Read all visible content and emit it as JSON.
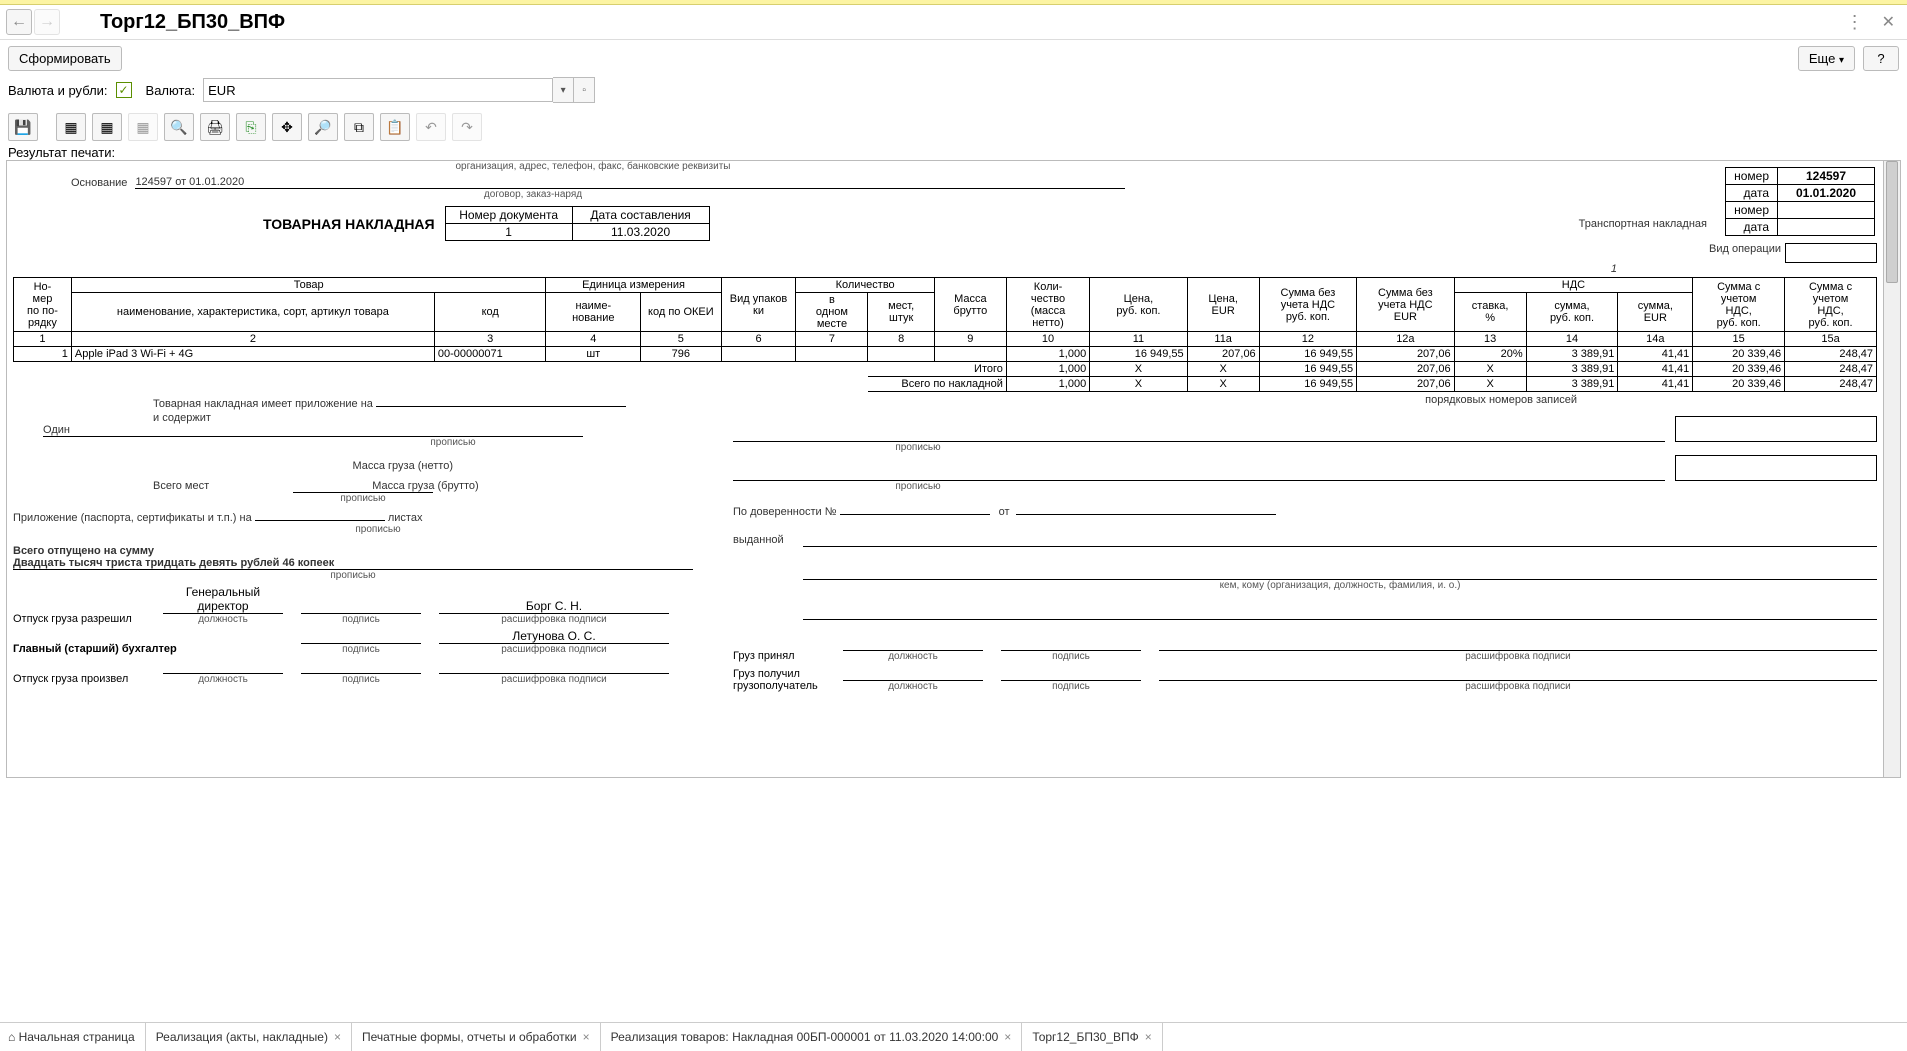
{
  "title": "Торг12_БП30_ВПФ",
  "buttons": {
    "form": "Сформировать",
    "more": "Еще",
    "help": "?"
  },
  "currency": {
    "label1": "Валюта и рубли:",
    "label2": "Валюта:",
    "value": "EUR"
  },
  "result_label": "Результат печати:",
  "header": {
    "org_caption": "организация, адрес, телефон, факс, банковские реквизиты",
    "basis_label": "Основание",
    "basis_value": "124597 от 01.01.2020",
    "basis_caption": "договор, заказ-наряд",
    "doc_title": "ТОВАРНАЯ НАКЛАДНАЯ",
    "doc_no_h": "Номер документа",
    "doc_date_h": "Дата составления",
    "doc_no": "1",
    "doc_date": "11.03.2020",
    "trans_title": "Транспортная накладная",
    "rbox": {
      "no_l": "номер",
      "no_v": "124597",
      "date_l": "дата",
      "date_v": "01.01.2020",
      "tn_l": "номер",
      "td_l": "дата"
    },
    "op_label": "Вид операции",
    "page_no": "1"
  },
  "tbl": {
    "h": {
      "c1": "Но-\nмер\nпо по-\nрядку",
      "c2g": "Товар",
      "c2a": "наименование, характеристика, сорт, артикул товара",
      "c2b": "код",
      "c3g": "Единица измерения",
      "c3a": "наиме-\nнование",
      "c3b": "код по ОКЕИ",
      "c4": "Вид упаков\nки",
      "c5g": "Количество",
      "c5a": "в\nодном\nместе",
      "c5b": "мест,\nштук",
      "c6": "Масса брутто",
      "c7": "Коли-\nчество\n(масса\nнетто)",
      "c8": "Цена,\nруб. коп.",
      "c8a": "Цена,\nEUR",
      "c9": "Сумма без\nучета НДС\nруб. коп.",
      "c9a": "Сумма без\nучета НДС\nEUR",
      "c10g": "НДС",
      "c10a": "ставка,\n%",
      "c10b": "сумма,\nруб. коп.",
      "c10c": "сумма,\nEUR",
      "c11": "Сумма с\nучетом\nНДС,\nруб. коп.",
      "c11a": "Сумма с\nучетом\nНДС,\nруб. коп."
    },
    "nums": [
      "1",
      "2",
      "3",
      "4",
      "5",
      "6",
      "7",
      "8",
      "9",
      "10",
      "11",
      "11а",
      "12",
      "12а",
      "13",
      "14",
      "14а",
      "15",
      "15а"
    ],
    "row": {
      "n": "1",
      "name": "Apple iPad 3 Wi-Fi + 4G",
      "code": "00-00000071",
      "unit": "шт",
      "okei": "796",
      "pack": "",
      "inone": "",
      "places": "",
      "brutto": "",
      "qty": "1,000",
      "price_r": "16 949,55",
      "price_e": "207,06",
      "sum_r": "16 949,55",
      "sum_e": "207,06",
      "vat_r": "20%",
      "vat_s_r": "3 389,91",
      "vat_s_e": "41,41",
      "tot_r": "20 339,46",
      "tot_e": "248,47"
    },
    "itogo_l": "Итого",
    "total_l": "Всего по накладной",
    "itogo": {
      "qty": "1,000",
      "price_r": "X",
      "price_e": "X",
      "sum_r": "16 949,55",
      "sum_e": "207,06",
      "vat_r": "X",
      "vat_s_r": "3 389,91",
      "vat_s_e": "41,41",
      "tot_r": "20 339,46",
      "tot_e": "248,47"
    },
    "total": {
      "qty": "1,000",
      "price_r": "X",
      "price_e": "X",
      "sum_r": "16 949,55",
      "sum_e": "207,06",
      "vat_r": "X",
      "vat_s_r": "3 389,91",
      "vat_s_e": "41,41",
      "tot_r": "20 339,46",
      "tot_e": "248,47"
    }
  },
  "footer": {
    "attach1": "Товарная накладная имеет приложение на",
    "attach2": "и содержит",
    "one": "Один",
    "rec": "порядковых номеров записей",
    "prop": "прописью",
    "mass_n": "Масса груза (нетто)",
    "mass_b": "Масса груза (брутто)",
    "places": "Всего мест",
    "appx": "Приложение (паспорта, сертификаты и т.п.) на",
    "sheets": "листах",
    "sum_l": "Всего отпущено  на сумму",
    "sum_w": "Двадцать тысяч триста тридцать девять рублей 46 копеек",
    "rel": "Отпуск груза разрешил",
    "pos": "Генеральный директор",
    "name1": "Борг С. Н.",
    "acc": "Главный (старший) бухгалтер",
    "name2": "Летунова О. С.",
    "made": "Отпуск груза произвел",
    "dov": "По доверенности №",
    "ot": "от",
    "vyd": "выданной",
    "vyd_c": "кем, кому (организация, должность, фамилия, и. о.)",
    "rcv": "Груз принял",
    "got": "Груз получил грузополучатель",
    "lbl_pos": "должность",
    "lbl_sig": "подпись",
    "lbl_dec": "расшифровка подписи"
  },
  "tabs": [
    "Начальная страница",
    "Реализация (акты, накладные)",
    "Печатные формы, отчеты и обработки",
    "Реализация товаров: Накладная 00БП-000001 от 11.03.2020 14:00:00",
    "Торг12_БП30_ВПФ"
  ]
}
